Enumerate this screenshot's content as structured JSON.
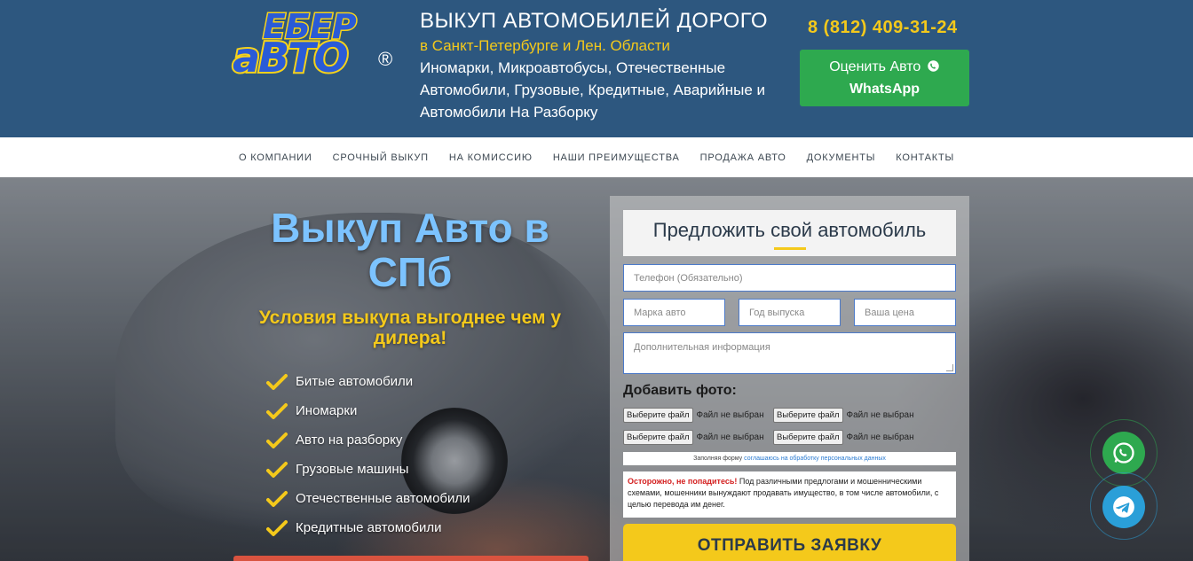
{
  "header": {
    "logo_top": "ЕБЕР",
    "logo_bottom": "аВТО",
    "logo_reg": "®",
    "title": "ВЫКУП АВТОМОБИЛЕЙ ДОРОГО",
    "subtitle": "в Санкт-Петербурге и Лен. Области",
    "description": "Иномарки, Микроавтобусы, Отечественные Автомобили, Грузовые, Кредитные, Аварийные и Автомобили На Разборку",
    "phone": "8 (812) 409-31-24",
    "whatsapp_line1": "Оценить Авто",
    "whatsapp_line2": "WhatsApp"
  },
  "nav": [
    "О КОМПАНИИ",
    "СРОЧНЫЙ ВЫКУП",
    "НА КОМИССИЮ",
    "НАШИ ПРЕИМУЩЕСТВА",
    "ПРОДАЖА АВТО",
    "ДОКУМЕНТЫ",
    "КОНТАКТЫ"
  ],
  "hero": {
    "title": "Выкуп Авто в СПб",
    "subtitle": "Условия выкупа выгоднее чем у дилера!",
    "list": [
      "Битые автомобили",
      "Иномарки",
      "Авто на разборку",
      "Грузовые машины",
      "Отечественные автомобили",
      "Кредитные автомобили"
    ]
  },
  "form": {
    "title": "Предложить свой автомобиль",
    "phone_placeholder": "Телефон (Обязательно)",
    "brand_placeholder": "Марка авто",
    "year_placeholder": "Год выпуска",
    "price_placeholder": "Ваша цена",
    "info_placeholder": "Дополнительная информация",
    "photo_label": "Добавить фото:",
    "file_button": "Выберите файл",
    "file_status": "Файл не выбран",
    "consent_text": "Заполняя форму",
    "consent_link": "соглашаюсь на обработку персональных данных",
    "warning_bold": "Осторожно, не попадитесь!",
    "warning_text": "Под различными предлогами и мошенническими схемами, мошенники вынуждают продавать имущество, в том числе автомобили, с целью перевода им денег.",
    "submit": "ОТПРАВИТЬ ЗАЯВКУ"
  },
  "colors": {
    "header_bg": "#2d577f",
    "accent_yellow": "#f4c91b",
    "whatsapp_green": "#2ea94f",
    "telegram_blue": "#2a9fd8",
    "hero_title_blue": "#7cc3ff"
  },
  "icons": {
    "whatsapp": "whatsapp-icon",
    "telegram": "telegram-icon",
    "check": "check-icon"
  }
}
